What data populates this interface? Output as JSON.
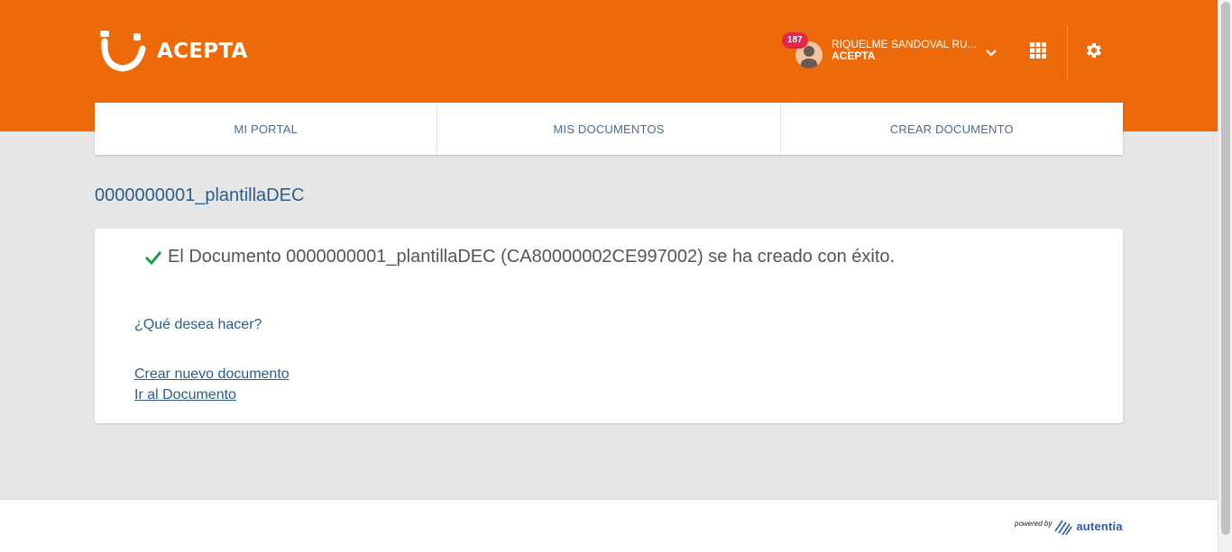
{
  "brand": {
    "name": "ACEPTA",
    "accent": "#ec6a0a"
  },
  "header": {
    "notifications_count": "187",
    "user_name": "RIQUELME SANDOVAL RU...",
    "user_org": "ACEPTA",
    "icons": [
      "user-avatar",
      "chevron-down-icon",
      "apps-grid-icon",
      "gear-icon"
    ]
  },
  "nav": {
    "items": [
      {
        "label": "MI PORTAL"
      },
      {
        "label": "MIS DOCUMENTOS"
      },
      {
        "label": "CREAR DOCUMENTO"
      }
    ]
  },
  "main": {
    "title": "0000000001_plantillaDEC",
    "success_message": "El Documento 0000000001_plantillaDEC (CA80000002CE997002) se ha creado con éxito.",
    "question": "¿Qué desea hacer?",
    "links": [
      {
        "label": "Crear nuevo documento"
      },
      {
        "label": "Ir al Documento"
      }
    ]
  },
  "footer": {
    "powered_by": "powered by",
    "provider": "autentia"
  }
}
